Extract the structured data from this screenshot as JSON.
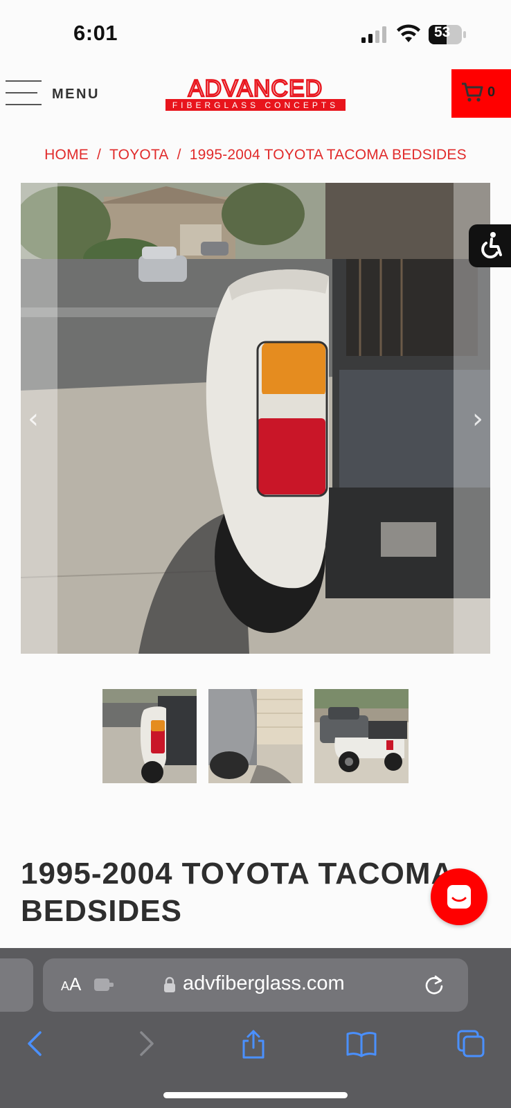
{
  "status_bar": {
    "time": "6:01",
    "battery": "53"
  },
  "header": {
    "menu_label": "MENU",
    "logo_main": "ADVANCED",
    "logo_sub": "FIBERGLASS CONCEPTS",
    "cart_count": "0"
  },
  "breadcrumb": {
    "items": [
      "HOME",
      "TOYOTA",
      "1995-2004 TOYOTA TACOMA BEDSIDES"
    ],
    "separator": "/"
  },
  "gallery": {
    "prev_glyph": "‹",
    "next_glyph": "›"
  },
  "thumbnails": [
    {
      "name": "thumbnail-1"
    },
    {
      "name": "thumbnail-2"
    },
    {
      "name": "thumbnail-3"
    }
  ],
  "product": {
    "title_line1": "1995-2004 TOYOTA TACOMA",
    "title_line2": "BEDSIDES"
  },
  "browser": {
    "aa_small": "A",
    "aa_big": "A",
    "url": "advfiberglass.com"
  },
  "colors": {
    "brand_red": "#ff0000",
    "breadcrumb_red": "#e12b2b",
    "safari_bar": "#5b5b5e",
    "toolbar_blue": "#4a90ff"
  }
}
